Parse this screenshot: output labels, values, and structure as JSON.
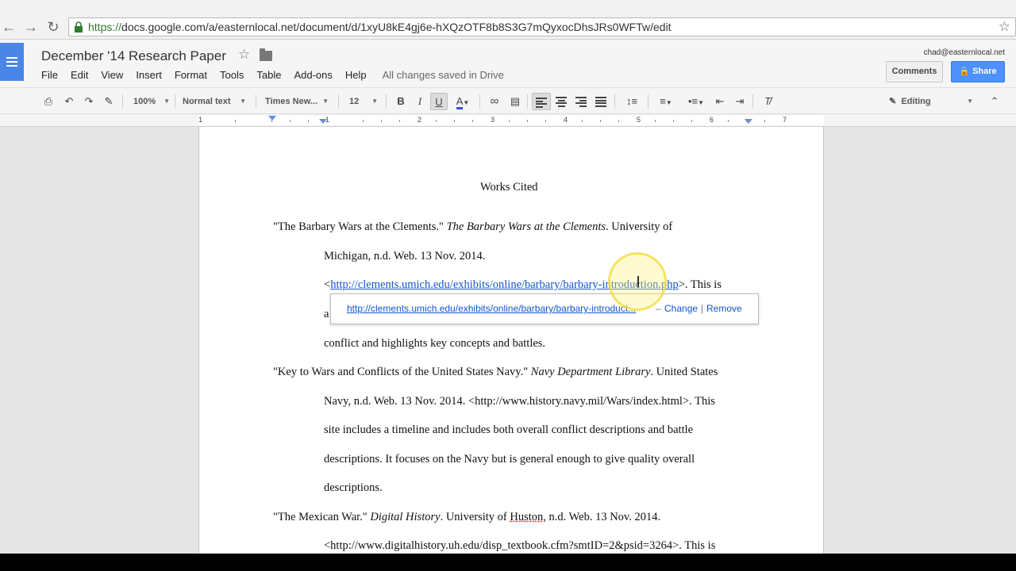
{
  "browser": {
    "url_scheme": "https://",
    "url_rest": "docs.google.com/a/easternlocal.net/document/d/1xyU8kE4gj6e-hXQzOTF8b8S3G7mQyxocDhsJRs0WFTw/edit"
  },
  "header": {
    "doc_title": "December '14 Research Paper",
    "user_email": "chad@easternlocal.net",
    "comments_label": "Comments",
    "share_label": "Share",
    "save_status": "All changes saved in Drive",
    "menu": [
      "File",
      "Edit",
      "View",
      "Insert",
      "Format",
      "Tools",
      "Table",
      "Add-ons",
      "Help"
    ]
  },
  "toolbar": {
    "zoom": "100%",
    "style": "Normal text",
    "font": "Times New...",
    "size": "12",
    "bold": "B",
    "italic": "I",
    "underline": "U",
    "text_color": "A",
    "mode": "Editing"
  },
  "ruler": {
    "marks": [
      "1",
      "1",
      "2",
      "3",
      "4",
      "5",
      "6",
      "7"
    ]
  },
  "document": {
    "heading": "Works Cited",
    "entry1": {
      "title_quoted": "\"The Barbary Wars at the Clements.\"",
      "site": "The Barbary Wars at the Clements",
      "l1_after": ". University of",
      "l2": "Michigan, n.d. Web. 13 Nov. 2014.",
      "l3_open": "<",
      "l3_link": "http://clements.umich.edu/exhibits/online/barbary/barbary-introduction.php",
      "l3_after": ">. This is",
      "l4_start": "a",
      "l5": "conflict and highlights key concepts and battles."
    },
    "entry2": {
      "title_quoted": "\"Key to Wars and Conflicts of the United States Navy.\"",
      "site": "Navy Department Library",
      "l1_after": ". United States",
      "l2": "Navy, n.d. Web. 13 Nov. 2014. <http://www.history.navy.mil/Wars/index.html>. This",
      "l3": "site includes a timeline and includes both overall conflict descriptions and battle",
      "l4": "descriptions. It focuses on the Navy but is general enough to give quality overall",
      "l5": "descriptions."
    },
    "entry3": {
      "title_quoted": "\"The Mexican War.\"",
      "site": "Digital History",
      "l1_mid": ". University of ",
      "l1_squig": "Huston",
      "l1_after": ", n.d. Web. 13 Nov. 2014.",
      "l2": "<http://www.digitalhistory.uh.edu/disp_textbook.cfm?smtID=2&psid=3264>. This is"
    }
  },
  "link_popup": {
    "url": "http://clements.umich.edu/exhibits/online/barbary/barbary-introduct...",
    "dash": "–",
    "change": "Change",
    "sep": "|",
    "remove": "Remove"
  }
}
